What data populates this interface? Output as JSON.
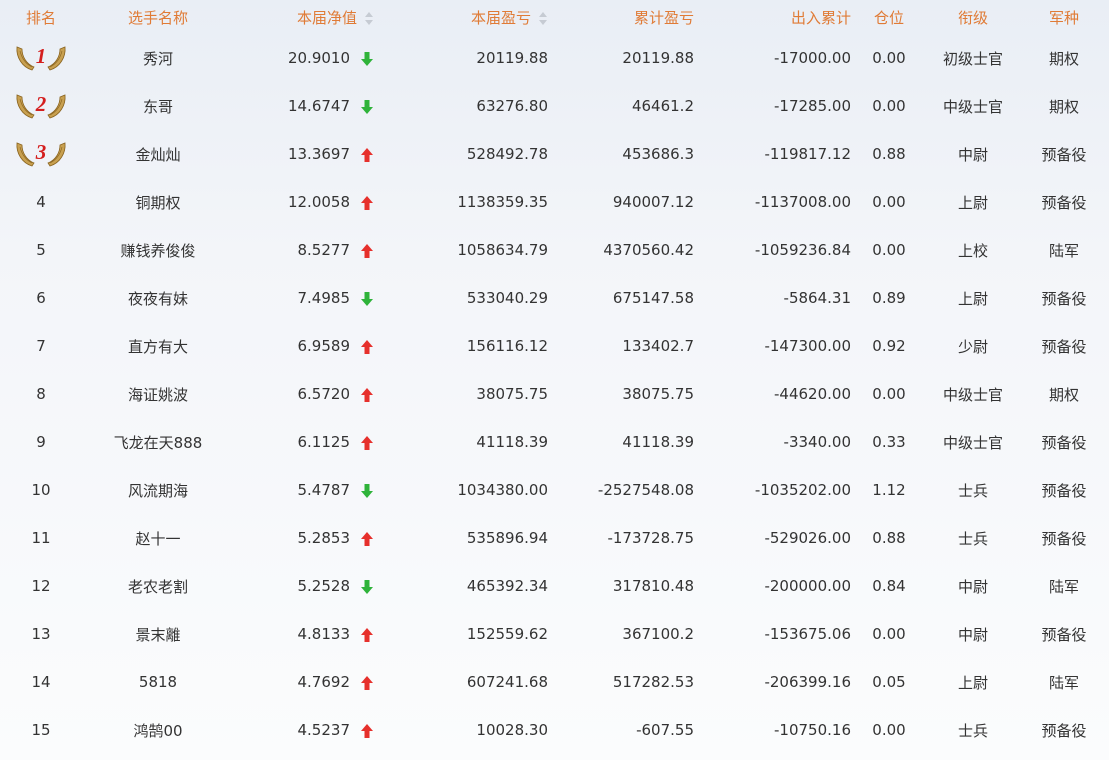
{
  "header": {
    "rank": "排名",
    "name": "选手名称",
    "nav": "本届净值",
    "profit": "本届盈亏",
    "cumulative": "累计盈亏",
    "flow": "出入累计",
    "position": "仓位",
    "title": "衔级",
    "branch": "军种"
  },
  "colors": {
    "header_text": "#e07b36",
    "up": "#e6302c",
    "down": "#2fb33a",
    "medal_text": "#d41e1e"
  },
  "rows": [
    {
      "rank": "1",
      "name": "秀河",
      "nav": "20.9010",
      "trend": "down",
      "profit": "20119.88",
      "cumulative": "20119.88",
      "flow": "-17000.00",
      "position": "0.00",
      "title": "初级士官",
      "branch": "期权"
    },
    {
      "rank": "2",
      "name": "东哥",
      "nav": "14.6747",
      "trend": "down",
      "profit": "63276.80",
      "cumulative": "46461.2",
      "flow": "-17285.00",
      "position": "0.00",
      "title": "中级士官",
      "branch": "期权"
    },
    {
      "rank": "3",
      "name": "金灿灿",
      "nav": "13.3697",
      "trend": "up",
      "profit": "528492.78",
      "cumulative": "453686.3",
      "flow": "-119817.12",
      "position": "0.88",
      "title": "中尉",
      "branch": "预备役"
    },
    {
      "rank": "4",
      "name": "铜期权",
      "nav": "12.0058",
      "trend": "up",
      "profit": "1138359.35",
      "cumulative": "940007.12",
      "flow": "-1137008.00",
      "position": "0.00",
      "title": "上尉",
      "branch": "预备役"
    },
    {
      "rank": "5",
      "name": "赚钱养俊俊",
      "nav": "8.5277",
      "trend": "up",
      "profit": "1058634.79",
      "cumulative": "4370560.42",
      "flow": "-1059236.84",
      "position": "0.00",
      "title": "上校",
      "branch": "陆军"
    },
    {
      "rank": "6",
      "name": "夜夜有妹",
      "nav": "7.4985",
      "trend": "down",
      "profit": "533040.29",
      "cumulative": "675147.58",
      "flow": "-5864.31",
      "position": "0.89",
      "title": "上尉",
      "branch": "预备役"
    },
    {
      "rank": "7",
      "name": "直方有大",
      "nav": "6.9589",
      "trend": "up",
      "profit": "156116.12",
      "cumulative": "133402.7",
      "flow": "-147300.00",
      "position": "0.92",
      "title": "少尉",
      "branch": "预备役"
    },
    {
      "rank": "8",
      "name": "海证姚波",
      "nav": "6.5720",
      "trend": "up",
      "profit": "38075.75",
      "cumulative": "38075.75",
      "flow": "-44620.00",
      "position": "0.00",
      "title": "中级士官",
      "branch": "期权"
    },
    {
      "rank": "9",
      "name": "飞龙在天888",
      "nav": "6.1125",
      "trend": "up",
      "profit": "41118.39",
      "cumulative": "41118.39",
      "flow": "-3340.00",
      "position": "0.33",
      "title": "中级士官",
      "branch": "预备役"
    },
    {
      "rank": "10",
      "name": "风流期海",
      "nav": "5.4787",
      "trend": "down",
      "profit": "1034380.00",
      "cumulative": "-2527548.08",
      "flow": "-1035202.00",
      "position": "1.12",
      "title": "士兵",
      "branch": "预备役"
    },
    {
      "rank": "11",
      "name": "赵十一",
      "nav": "5.2853",
      "trend": "up",
      "profit": "535896.94",
      "cumulative": "-173728.75",
      "flow": "-529026.00",
      "position": "0.88",
      "title": "士兵",
      "branch": "预备役"
    },
    {
      "rank": "12",
      "name": "老农老割",
      "nav": "5.2528",
      "trend": "down",
      "profit": "465392.34",
      "cumulative": "317810.48",
      "flow": "-200000.00",
      "position": "0.84",
      "title": "中尉",
      "branch": "陆军"
    },
    {
      "rank": "13",
      "name": "景末離",
      "nav": "4.8133",
      "trend": "up",
      "profit": "152559.62",
      "cumulative": "367100.2",
      "flow": "-153675.06",
      "position": "0.00",
      "title": "中尉",
      "branch": "预备役"
    },
    {
      "rank": "14",
      "name": "5818",
      "nav": "4.7692",
      "trend": "up",
      "profit": "607241.68",
      "cumulative": "517282.53",
      "flow": "-206399.16",
      "position": "0.05",
      "title": "上尉",
      "branch": "陆军"
    },
    {
      "rank": "15",
      "name": "鸿鹄00",
      "nav": "4.5237",
      "trend": "up",
      "profit": "10028.30",
      "cumulative": "-607.55",
      "flow": "-10750.16",
      "position": "0.00",
      "title": "士兵",
      "branch": "预备役"
    }
  ]
}
